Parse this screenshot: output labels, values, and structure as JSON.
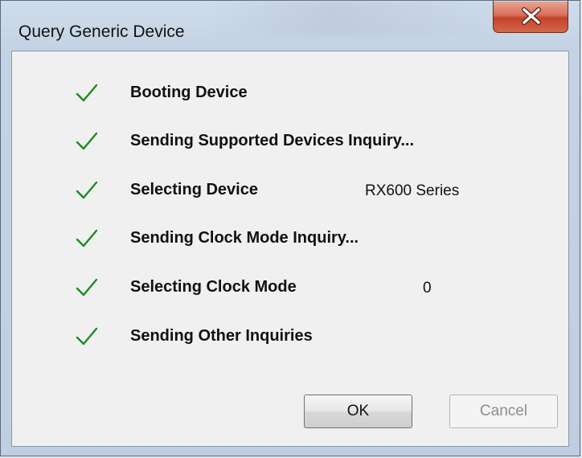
{
  "window": {
    "title": "Query Generic Device"
  },
  "steps": [
    {
      "label": "Booting Device",
      "value": "",
      "status": "done"
    },
    {
      "label": "Sending Supported Devices Inquiry...",
      "value": "",
      "status": "done"
    },
    {
      "label": "Selecting Device",
      "value": "RX600 Series",
      "status": "done"
    },
    {
      "label": "Sending Clock Mode Inquiry...",
      "value": "",
      "status": "done"
    },
    {
      "label": "Selecting Clock Mode",
      "value": "0",
      "status": "done"
    },
    {
      "label": "Sending Other Inquiries",
      "value": "",
      "status": "done"
    }
  ],
  "buttons": {
    "ok_label": "OK",
    "cancel_label": "Cancel",
    "cancel_enabled": false
  },
  "icons": {
    "step_status": "checkmark-icon",
    "close": "close-icon"
  },
  "colors": {
    "checkmark": "#1f8a1f",
    "close_button": "#c9452c",
    "disabled_text": "#8d8d8d"
  }
}
